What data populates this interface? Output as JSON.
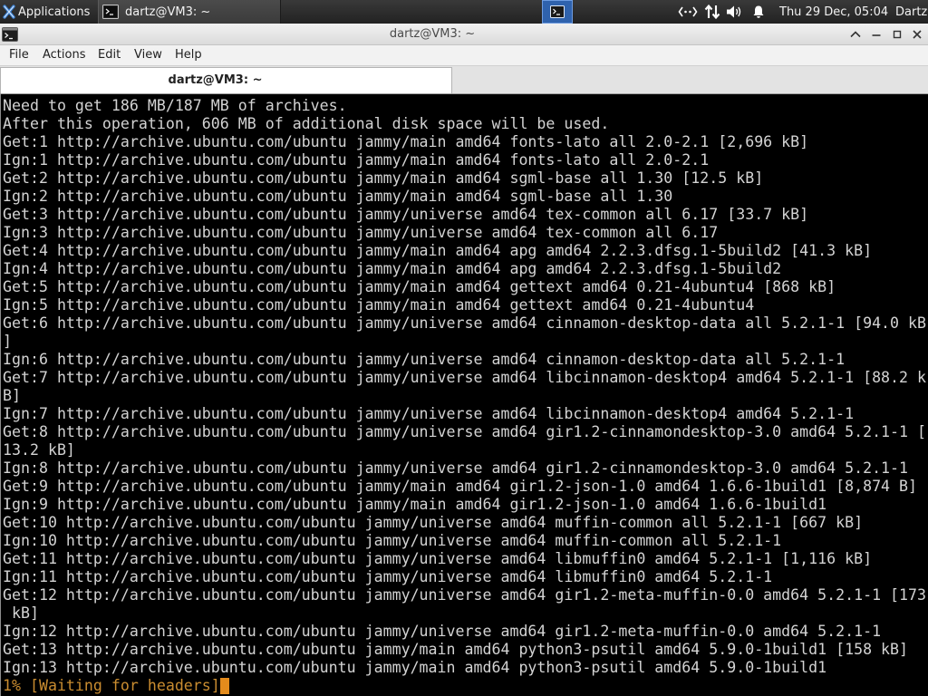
{
  "panel": {
    "applications_label": "Applications",
    "applications_icon": "xfce-logo-icon",
    "task_title": "dartz@VM3: ~",
    "task_icon": "terminal-icon",
    "pager_icon": "terminal-icon",
    "tray_icons": [
      "network-icon",
      "network-activity-icon",
      "volume-icon",
      "notification-bell-icon"
    ],
    "clock": "Thu 29 Dec, 05:04",
    "user": "Dartz"
  },
  "window": {
    "title": "dartz@VM3: ~",
    "icon": "terminal-icon",
    "control_icons": [
      "chevron-up-icon",
      "minimize-icon",
      "maximize-icon",
      "close-icon"
    ]
  },
  "menubar": {
    "items": [
      "File",
      "Actions",
      "Edit",
      "View",
      "Help"
    ]
  },
  "tabs": [
    {
      "label": "dartz@VM3: ~",
      "active": true
    }
  ],
  "terminal": {
    "lines": [
      "Need to get 186 MB/187 MB of archives.",
      "After this operation, 606 MB of additional disk space will be used.",
      "Get:1 http://archive.ubuntu.com/ubuntu jammy/main amd64 fonts-lato all 2.0-2.1 [2,696 kB]",
      "Ign:1 http://archive.ubuntu.com/ubuntu jammy/main amd64 fonts-lato all 2.0-2.1",
      "Get:2 http://archive.ubuntu.com/ubuntu jammy/main amd64 sgml-base all 1.30 [12.5 kB]",
      "Ign:2 http://archive.ubuntu.com/ubuntu jammy/main amd64 sgml-base all 1.30",
      "Get:3 http://archive.ubuntu.com/ubuntu jammy/universe amd64 tex-common all 6.17 [33.7 kB]",
      "Ign:3 http://archive.ubuntu.com/ubuntu jammy/universe amd64 tex-common all 6.17",
      "Get:4 http://archive.ubuntu.com/ubuntu jammy/main amd64 apg amd64 2.2.3.dfsg.1-5build2 [41.3 kB]",
      "Ign:4 http://archive.ubuntu.com/ubuntu jammy/main amd64 apg amd64 2.2.3.dfsg.1-5build2",
      "Get:5 http://archive.ubuntu.com/ubuntu jammy/main amd64 gettext amd64 0.21-4ubuntu4 [868 kB]",
      "Ign:5 http://archive.ubuntu.com/ubuntu jammy/main amd64 gettext amd64 0.21-4ubuntu4",
      "Get:6 http://archive.ubuntu.com/ubuntu jammy/universe amd64 cinnamon-desktop-data all 5.2.1-1 [94.0 kB",
      "]",
      "Ign:6 http://archive.ubuntu.com/ubuntu jammy/universe amd64 cinnamon-desktop-data all 5.2.1-1",
      "Get:7 http://archive.ubuntu.com/ubuntu jammy/universe amd64 libcinnamon-desktop4 amd64 5.2.1-1 [88.2 k",
      "B]",
      "Ign:7 http://archive.ubuntu.com/ubuntu jammy/universe amd64 libcinnamon-desktop4 amd64 5.2.1-1",
      "Get:8 http://archive.ubuntu.com/ubuntu jammy/universe amd64 gir1.2-cinnamondesktop-3.0 amd64 5.2.1-1 [",
      "13.2 kB]",
      "Ign:8 http://archive.ubuntu.com/ubuntu jammy/universe amd64 gir1.2-cinnamondesktop-3.0 amd64 5.2.1-1",
      "Get:9 http://archive.ubuntu.com/ubuntu jammy/main amd64 gir1.2-json-1.0 amd64 1.6.6-1build1 [8,874 B]",
      "Ign:9 http://archive.ubuntu.com/ubuntu jammy/main amd64 gir1.2-json-1.0 amd64 1.6.6-1build1",
      "Get:10 http://archive.ubuntu.com/ubuntu jammy/universe amd64 muffin-common all 5.2.1-1 [667 kB]",
      "Ign:10 http://archive.ubuntu.com/ubuntu jammy/universe amd64 muffin-common all 5.2.1-1",
      "Get:11 http://archive.ubuntu.com/ubuntu jammy/universe amd64 libmuffin0 amd64 5.2.1-1 [1,116 kB]",
      "Ign:11 http://archive.ubuntu.com/ubuntu jammy/universe amd64 libmuffin0 amd64 5.2.1-1",
      "Get:12 http://archive.ubuntu.com/ubuntu jammy/universe amd64 gir1.2-meta-muffin-0.0 amd64 5.2.1-1 [173",
      " kB]",
      "Ign:12 http://archive.ubuntu.com/ubuntu jammy/universe amd64 gir1.2-meta-muffin-0.0 amd64 5.2.1-1",
      "Get:13 http://archive.ubuntu.com/ubuntu jammy/main amd64 python3-psutil amd64 5.9.0-1build1 [158 kB]",
      "Ign:13 http://archive.ubuntu.com/ubuntu jammy/main amd64 python3-psutil amd64 5.9.0-1build1"
    ],
    "status_line": "1% [Waiting for headers]"
  },
  "colors": {
    "terminal_background": "#000000",
    "terminal_text": "#d3d3d3",
    "status_text": "#c98c30",
    "cursor": "#e38b1c",
    "pager_active": "#2f62ad"
  }
}
